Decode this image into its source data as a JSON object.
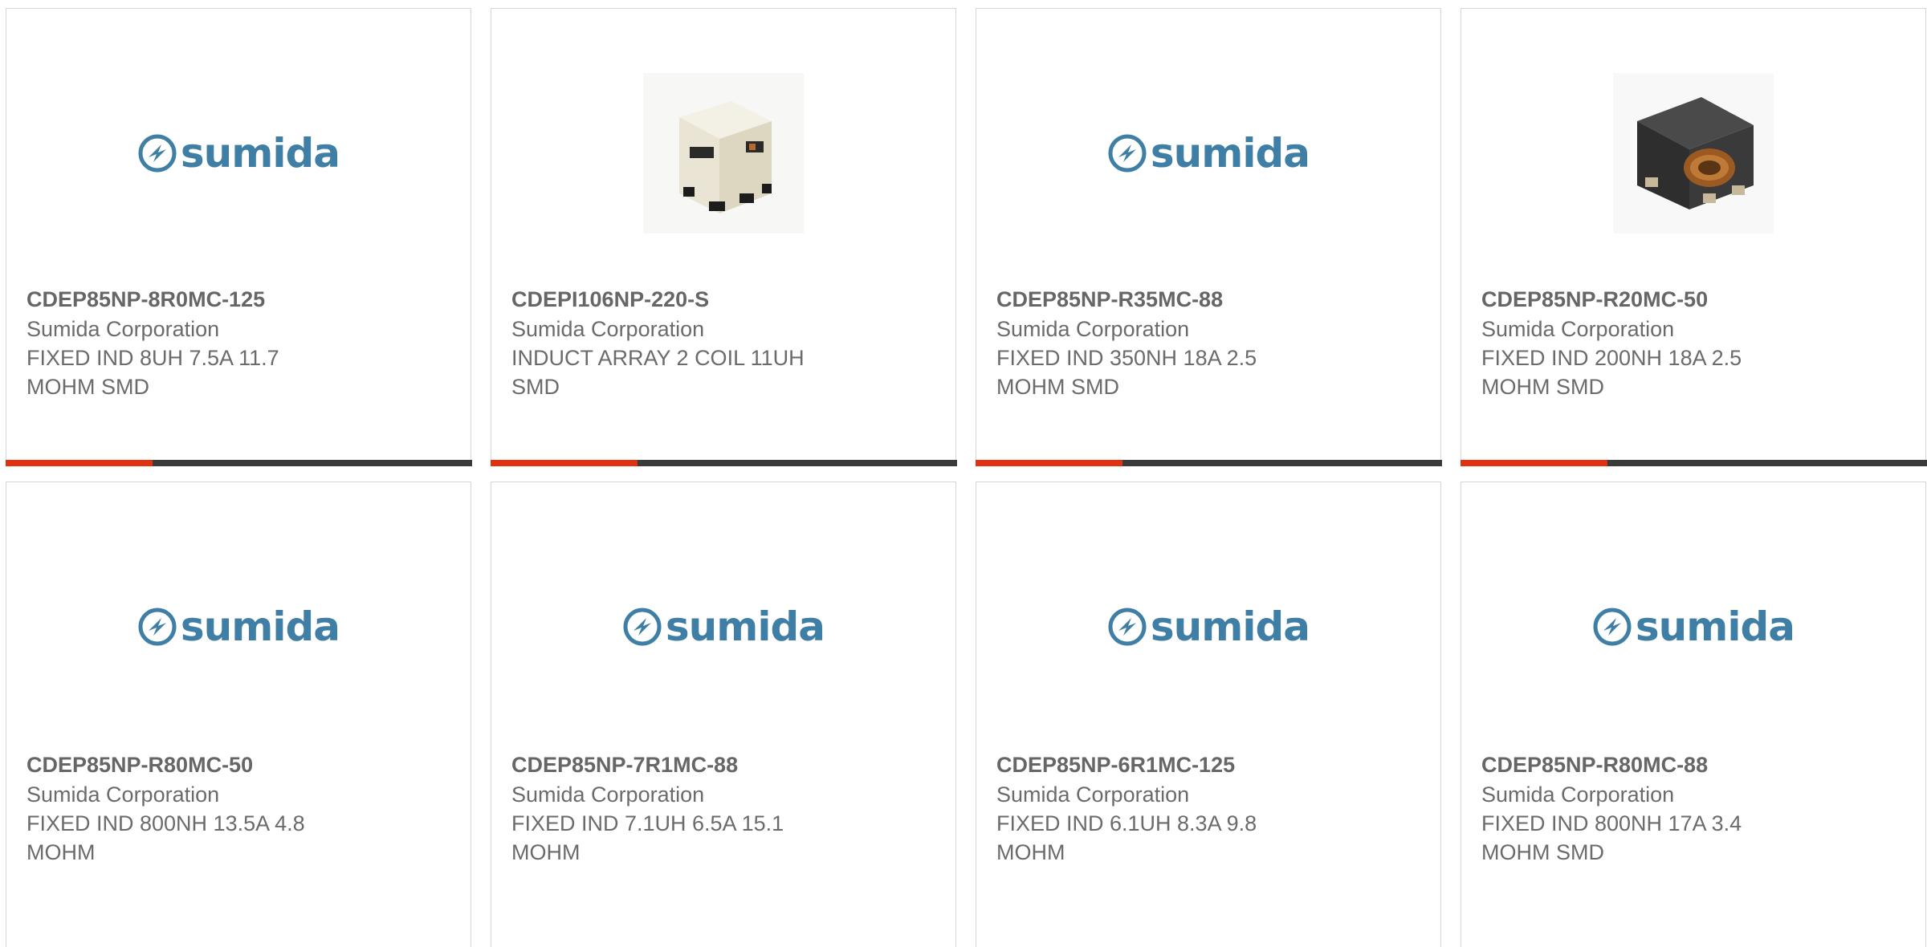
{
  "colors": {
    "accent": "#e0320f",
    "bar_dark": "#3a3a3a",
    "brand_blue": "#3f7fa6"
  },
  "products": [
    {
      "part_number": "CDEP85NP-8R0MC-125",
      "manufacturer": "Sumida Corporation",
      "description": "FIXED IND 8UH 7.5A 11.7\nMOHM SMD",
      "image": "sumida-logo"
    },
    {
      "part_number": "CDEPI106NP-220-S",
      "manufacturer": "Sumida Corporation",
      "description": "INDUCT ARRAY 2 COIL 11UH\nSMD",
      "image": "white-inductor-photo"
    },
    {
      "part_number": "CDEP85NP-R35MC-88",
      "manufacturer": "Sumida Corporation",
      "description": "FIXED IND 350NH 18A 2.5\nMOHM SMD",
      "image": "sumida-logo"
    },
    {
      "part_number": "CDEP85NP-R20MC-50",
      "manufacturer": "Sumida Corporation",
      "description": "FIXED IND 200NH 18A 2.5\nMOHM SMD",
      "image": "black-inductor-photo"
    },
    {
      "part_number": "CDEP85NP-R80MC-50",
      "manufacturer": "Sumida Corporation",
      "description": "FIXED IND 800NH 13.5A 4.8\nMOHM",
      "image": "sumida-logo"
    },
    {
      "part_number": "CDEP85NP-7R1MC-88",
      "manufacturer": "Sumida Corporation",
      "description": "FIXED IND 7.1UH 6.5A 15.1\nMOHM",
      "image": "sumida-logo"
    },
    {
      "part_number": "CDEP85NP-6R1MC-125",
      "manufacturer": "Sumida Corporation",
      "description": "FIXED IND 6.1UH 8.3A 9.8\nMOHM",
      "image": "sumida-logo"
    },
    {
      "part_number": "CDEP85NP-R80MC-88",
      "manufacturer": "Sumida Corporation",
      "description": "FIXED IND 800NH 17A 3.4\nMOHM SMD",
      "image": "sumida-logo"
    }
  ],
  "logo_text": "sumida"
}
